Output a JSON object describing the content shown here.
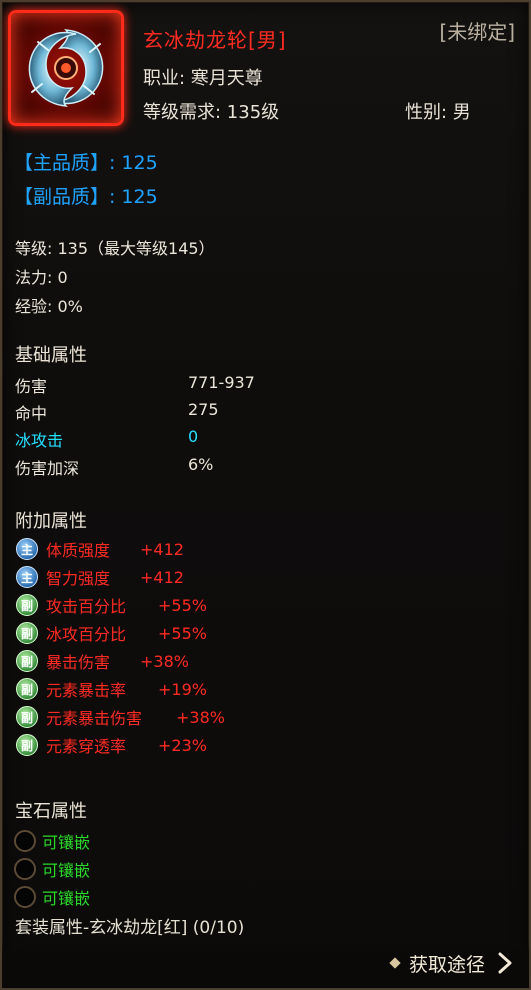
{
  "item": {
    "name": "玄冰劫龙轮[男]",
    "bind_status": "[未绑定]",
    "profession": "职业:  寒月天尊",
    "level_req": "等级需求:  135级",
    "gender": "性别:  男",
    "icon": "frost-dragon-wheel-icon"
  },
  "quality": {
    "main_label": "【主品质】:",
    "main_value": "125",
    "sub_label": "【副品质】:",
    "sub_value": "125"
  },
  "info": {
    "level": "等级:  135（最大等级145）",
    "mana": "法力:  0",
    "exp": "经验:  0%"
  },
  "base_attrs": {
    "title": "基础属性",
    "rows": [
      {
        "name": "伤害",
        "value": "771-937"
      },
      {
        "name": "命中",
        "value": "275"
      },
      {
        "name": "冰攻击",
        "value": "0"
      },
      {
        "name": "伤害加深",
        "value": "6%"
      }
    ]
  },
  "extra_attrs": {
    "title": "附加属性",
    "badge_main": "主",
    "badge_sub": "副",
    "rows": [
      {
        "type": "main",
        "name": "体质强度",
        "value": "+412"
      },
      {
        "type": "main",
        "name": "智力强度",
        "value": "+412"
      },
      {
        "type": "sub",
        "name": "攻击百分比",
        "value": "+55%"
      },
      {
        "type": "sub",
        "name": "冰攻百分比",
        "value": "+55%"
      },
      {
        "type": "sub",
        "name": "暴击伤害",
        "value": "+38%"
      },
      {
        "type": "sub",
        "name": "元素暴击率",
        "value": "+19%"
      },
      {
        "type": "sub",
        "name": "元素暴击伤害",
        "value": "+38%"
      },
      {
        "type": "sub",
        "name": "元素穿透率",
        "value": "+23%"
      }
    ]
  },
  "gems": {
    "title": "宝石属性",
    "slots": [
      "可镶嵌",
      "可镶嵌",
      "可镶嵌"
    ]
  },
  "set": {
    "title": "套装属性-玄冰劫龙[红] (0/10)"
  },
  "footer": {
    "get_path_label": "获取途径"
  },
  "colors": {
    "name": "#ff2b22",
    "quality": "#1fa3ff",
    "cyan_attr": "#24e0ff",
    "affix": "#ff2a22",
    "gem": "#2bd92b"
  }
}
